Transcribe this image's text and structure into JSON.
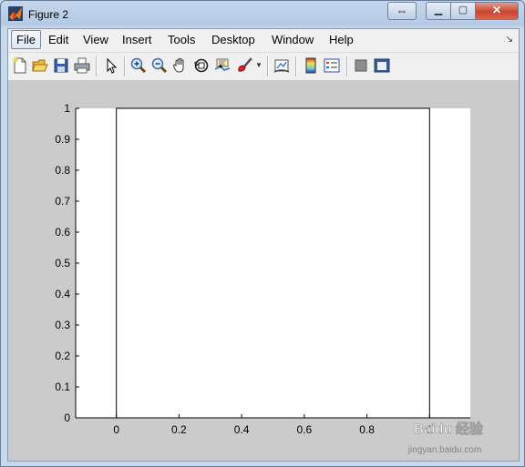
{
  "window": {
    "title": "Figure 2"
  },
  "menu": [
    "File",
    "Edit",
    "View",
    "Insert",
    "Tools",
    "Desktop",
    "Window",
    "Help"
  ],
  "toolbar_icons": [
    "new-figure-icon",
    "open-file-icon",
    "save-icon",
    "print-icon",
    "pointer-icon",
    "zoom-in-icon",
    "zoom-out-icon",
    "pan-hand-icon",
    "rotate-3d-icon",
    "data-cursor-icon",
    "brush-icon",
    "link-plot-icon",
    "colorbar-icon",
    "legend-icon",
    "hide-plot-tools-icon",
    "show-plot-tools-icon"
  ],
  "chart_data": {
    "type": "line",
    "title": "",
    "xlabel": "",
    "ylabel": "",
    "xlim": [
      -0.13,
      1.13
    ],
    "ylim": [
      0,
      1
    ],
    "x_ticks": [
      "0",
      "0.2",
      "0.4",
      "0.6",
      "0.8",
      "1"
    ],
    "y_ticks": [
      "0",
      "0.1",
      "0.2",
      "0.3",
      "0.4",
      "0.5",
      "0.6",
      "0.7",
      "0.8",
      "0.9",
      "1"
    ],
    "series": [
      {
        "x": [
          0,
          0,
          1,
          1
        ],
        "y": [
          0,
          1,
          1,
          0
        ]
      }
    ]
  },
  "watermark": {
    "line1": "Baidu 经验",
    "line2": "jingyan.baidu.com"
  }
}
